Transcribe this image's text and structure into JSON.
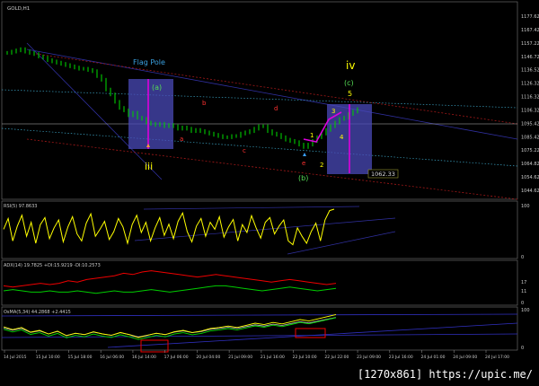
{
  "symbol_label": "GOLD,H1",
  "watermark": "[1270x861] https://upic.me/",
  "colors": {
    "background": "#000000",
    "price_bars": "#00cc00",
    "box": "#4a4ab8",
    "wave_line": "#dd00dd",
    "channel_blue": "#3030a0",
    "channel_red": "#a01818",
    "cyan_guide": "#3aa0c0",
    "yellow_label": "#ffff00",
    "red_label": "#ff3030",
    "green_label": "#55dd55",
    "rsi": "#ffff00",
    "adx_red": "#ee0000",
    "adx_green": "#00cc00"
  },
  "chart_data": [
    {
      "type": "line",
      "panel": "price",
      "title": "GOLD,H1",
      "ylim": [
        1044.62,
        1187.0
      ],
      "y_ticks": [
        "1177.62",
        "1167.42",
        "1157.22",
        "1146.72",
        "1136.52",
        "1126.32",
        "1116.32",
        "1106.32",
        "1095.42",
        "1085.42",
        "1075.22",
        "1064.82",
        "1054.62",
        "1044.62"
      ],
      "series": [
        {
          "values": [
            1157,
            1158,
            1159,
            1160,
            1158,
            1157,
            1156,
            1154,
            1153,
            1151,
            1150,
            1149,
            1148,
            1147,
            1146,
            1145,
            1144,
            1144,
            1143,
            1142,
            1138,
            1135,
            1127,
            1123,
            1117,
            1112,
            1110,
            1106,
            1108,
            1104,
            1103,
            1100,
            1099,
            1098,
            1099,
            1097,
            1098,
            1097,
            1095,
            1096,
            1095,
            1093,
            1094,
            1093,
            1092,
            1091,
            1090,
            1089,
            1088,
            1088,
            1089,
            1089,
            1091,
            1092,
            1093,
            1095,
            1097,
            1097,
            1093,
            1091,
            1090,
            1088,
            1086,
            1085,
            1084,
            1082,
            1080,
            1082,
            1085,
            1088,
            1091,
            1094,
            1097,
            1100,
            1103,
            1104,
            1107,
            1109,
            1111
          ]
        }
      ],
      "annotations": {
        "flag_pole": "Flag Pole",
        "a_paren": "(a)",
        "c_paren": "(c)",
        "b_paren": "(b)",
        "wave_iv": "iv",
        "wave_iii": "iii",
        "small_a": "a",
        "small_b": "b",
        "small_c": "c",
        "small_d": "d",
        "small_e": "e",
        "n1": "1",
        "n2": "2",
        "n3": "3",
        "n4": "4",
        "n5": "5",
        "price_tag": "1062.33"
      }
    },
    {
      "type": "line",
      "panel": "rsi",
      "title": "RSI(5) 97.8633",
      "ylim": [
        0,
        100
      ],
      "y_ticks": [
        "100",
        "0"
      ],
      "series": [
        {
          "values": [
            55,
            78,
            30,
            62,
            85,
            40,
            70,
            25,
            65,
            80,
            35,
            58,
            75,
            28,
            60,
            82,
            45,
            30,
            68,
            88,
            40,
            55,
            72,
            33,
            50,
            78,
            60,
            25,
            65,
            85,
            48,
            70,
            30,
            58,
            80,
            42,
            66,
            35,
            72,
            90,
            50,
            28,
            62,
            78,
            40,
            70,
            55,
            82,
            38,
            60,
            76,
            30,
            65,
            48,
            84,
            58,
            36,
            70,
            80,
            45,
            62,
            75,
            30,
            22,
            58,
            40,
            25,
            50,
            68,
            30,
            75,
            95,
            98
          ]
        }
      ]
    },
    {
      "type": "line",
      "panel": "adx",
      "title": "ADX(14) 19.7825 +DI:15.9219 -DI:10.2573",
      "y_ticks": [
        "17",
        "11",
        "0"
      ],
      "series": [
        {
          "values": [
            14,
            13,
            14,
            15,
            16,
            15,
            16,
            18,
            17,
            19,
            20,
            21,
            22,
            24,
            23,
            25,
            26,
            25,
            24,
            23,
            22,
            21,
            22,
            23,
            22,
            21,
            20,
            19,
            18,
            17,
            18,
            19,
            18,
            17,
            16,
            15,
            16
          ]
        },
        {
          "values": [
            10,
            11,
            10,
            9,
            9,
            10,
            9,
            9,
            10,
            9,
            8,
            9,
            10,
            9,
            9,
            10,
            11,
            10,
            9,
            10,
            11,
            12,
            13,
            14,
            14,
            13,
            12,
            11,
            10,
            11,
            12,
            13,
            12,
            11,
            10,
            11,
            12
          ]
        }
      ]
    },
    {
      "type": "line",
      "panel": "oscillator",
      "title": "OsMA(5,34) 44.2868 +2.4415",
      "y_ticks": [
        "100",
        "0"
      ],
      "x_ticks": [
        "14 Jul 2015",
        "15 Jul 10:00",
        "15 Jul 18:00",
        "16 Jul 06:00",
        "16 Jul 14:00",
        "17 Jul 06:00",
        "20 Jul 04:00",
        "21 Jul 09:00",
        "21 Jul 16:00",
        "22 Jul 10:00",
        "22 Jul 22:00",
        "23 Jul 09:00",
        "23 Jul 16:00",
        "24 Jul 01:00",
        "24 Jul 09:00",
        "24 Jul 17:00"
      ],
      "series": [
        {
          "values": [
            60,
            52,
            58,
            45,
            50,
            40,
            48,
            35,
            42,
            38,
            46,
            40,
            36,
            44,
            38,
            30,
            36,
            42,
            38,
            46,
            50,
            44,
            48,
            55,
            58,
            62,
            58,
            64,
            70,
            66,
            72,
            68,
            74,
            80,
            76,
            82,
            88,
            94
          ]
        }
      ]
    }
  ]
}
